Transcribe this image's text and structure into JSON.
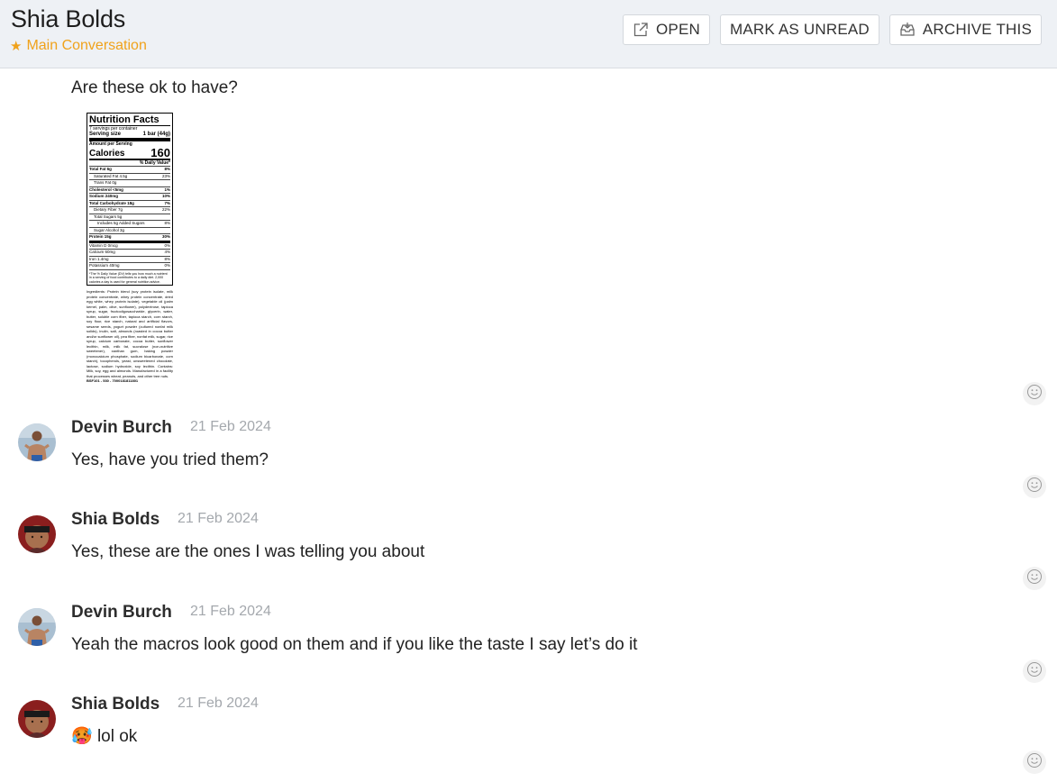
{
  "header": {
    "title": "Shia Bolds",
    "subtitle": "Main Conversation",
    "buttons": {
      "open": "OPEN",
      "mark_unread": "MARK AS UNREAD",
      "archive": "ARCHIVE THIS"
    }
  },
  "first_message": {
    "text": "Are these ok to have?"
  },
  "nutrition_label": {
    "title": "Nutrition Facts",
    "servings": "7 servings per container",
    "serving_size_label": "Serving size",
    "serving_size_value": "1 bar (44g)",
    "amount_per_serving": "Amount per Serving",
    "calories_label": "Calories",
    "calories_value": "160",
    "daily_value_header": "% Daily Value*",
    "rows": [
      {
        "label": "Total Fat 6g",
        "dv": "8%",
        "bold": true
      },
      {
        "label": "Saturated Fat 4.5g",
        "dv": "23%",
        "indent": 1
      },
      {
        "label": "Trans Fat 0g",
        "dv": "",
        "indent": 1
      },
      {
        "label": "Cholesterol <5mg",
        "dv": "1%",
        "bold": true
      },
      {
        "label": "Sodium 240mg",
        "dv": "10%",
        "bold": true
      },
      {
        "label": "Total Carbohydrate 18g",
        "dv": "7%",
        "bold": true
      },
      {
        "label": "Dietary Fiber 7g",
        "dv": "22%",
        "indent": 1
      },
      {
        "label": "Total Sugars 5g",
        "dv": "",
        "indent": 1
      },
      {
        "label": "Includes 5g Added Sugars",
        "dv": "8%",
        "indent": 2
      },
      {
        "label": "Sugar Alcohol 3g",
        "dv": "",
        "indent": 1
      },
      {
        "label": "Protein 15g",
        "dv": "30%",
        "bold": true,
        "thick": true
      },
      {
        "label": "Vitamin D 0mcg",
        "dv": "0%"
      },
      {
        "label": "Calcium 60mg",
        "dv": "4%"
      },
      {
        "label": "Iron 1.4mg",
        "dv": "8%"
      },
      {
        "label": "Potassium 40mg",
        "dv": "0%"
      }
    ],
    "footnote": "*The % Daily Value (DV) tells you how much a nutrient in a serving of food contributes to a daily diet. 2,000 calories a day is used for general nutrition advice.",
    "ingredients": "Ingredients: Protein blend (soy protein isolate, milk protein concentrate, whey protein concentrate, dried egg white, whey protein isolate), vegetable oil (palm kernel, palm, olive, sunflower), polydextrose, tapioca syrup, sugar, fructooligosaccharide, glycerin, water, butter, soluble corn fiber, tapioca starch, corn starch, soy flour, rice starch, natural and artificial flavors, sesame seeds, yogurt powder (cultured nonfat milk solids), inulin, salt, almonds (roasted in cocoa butter and/or sunflower oil), pea fiber, nonfat milk, sugar, rice syrup, calcium carbonate, cocoa butter, sunflower lecithin, milk, milk fat, sucralose (non-nutritive sweetener), xanthan gum, baking powder (monocalcium phosphate, sodium bicarbonate, corn starch), tocopherols, yeast, unsweetened chocolate, lactose, sodium hydroxide, soy lecithin. Contains: Milk, soy, egg and almonds. Manufactured in a facility that processes wheat, peanuts, and other tree nuts.",
    "code": "BSF101 - 530 - 7000181811801"
  },
  "messages": [
    {
      "sender": "Devin Burch",
      "date": "21 Feb 2024",
      "text": "Yes, have you tried them?",
      "avatar": "devin"
    },
    {
      "sender": "Shia Bolds",
      "date": "21 Feb 2024",
      "text": "Yes, these are the ones I was telling you about",
      "avatar": "shia"
    },
    {
      "sender": "Devin Burch",
      "date": "21 Feb 2024",
      "text": "Yeah the macros look good on them and if you like the taste I say let’s do it",
      "avatar": "devin"
    },
    {
      "sender": "Shia Bolds",
      "date": "21 Feb 2024",
      "text": "lol ok",
      "emoji": "🥵",
      "avatar": "shia"
    }
  ],
  "icons": {
    "open": "external-link-icon",
    "archive": "archive-tray-icon",
    "reaction": "smiley-icon",
    "star": "star-icon"
  },
  "colors": {
    "accent": "#f0a21b",
    "header_bg": "#eef1f5",
    "date": "#a4a8ad"
  }
}
